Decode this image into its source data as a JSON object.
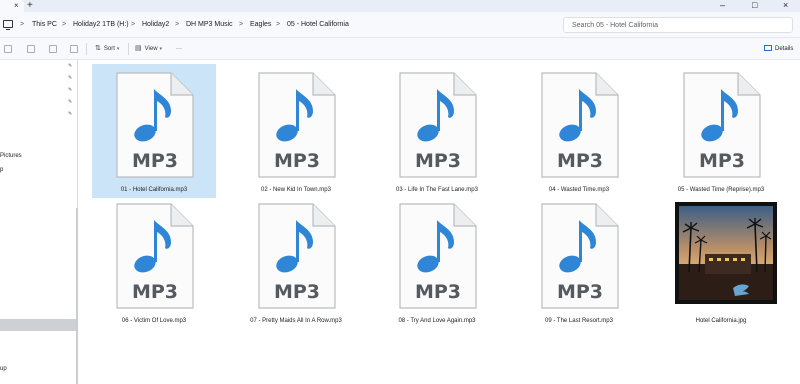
{
  "window": {
    "tab_glyph": "⌂",
    "tab_close": "×",
    "new_tab": "+",
    "minimize": "–",
    "maximize": "□",
    "close": "×"
  },
  "address": {
    "breadcrumbs": [
      "This PC",
      "Holiday2 1TB (H:)",
      "Holiday2",
      "DH MP3 Music",
      "Eagles",
      "05 - Hotel California"
    ],
    "separator": ">",
    "search_placeholder": "Search 05 - Hotel California"
  },
  "toolbar": {
    "sort_label": "Sort",
    "view_label": "View",
    "more_label": "···",
    "details_label": "Details"
  },
  "nav": {
    "items": [
      "Pictures",
      "p",
      "up"
    ]
  },
  "files": [
    {
      "name": "01 - Hotel California.mp3",
      "type": "mp3",
      "selected": true
    },
    {
      "name": "02 - New Kid In Town.mp3",
      "type": "mp3"
    },
    {
      "name": "03 - Life In The Fast Lane.mp3",
      "type": "mp3"
    },
    {
      "name": "04 - Wasted Time.mp3",
      "type": "mp3"
    },
    {
      "name": "05 - Wasted Time (Reprise).mp3",
      "type": "mp3"
    },
    {
      "name": "06 - Victim Of Love.mp3",
      "type": "mp3"
    },
    {
      "name": "07 - Pretty Maids All In A Row.mp3",
      "type": "mp3"
    },
    {
      "name": "08 - Try And Love Again.mp3",
      "type": "mp3"
    },
    {
      "name": "09 - The Last Resort.mp3",
      "type": "mp3"
    },
    {
      "name": "Hotel California.jpg",
      "type": "jpg"
    }
  ],
  "mp3_icon_label": "MP3",
  "colors": {
    "accent": "#1f6fd1",
    "selection": "#cce4f7",
    "note_blue": "#2f86d6"
  }
}
